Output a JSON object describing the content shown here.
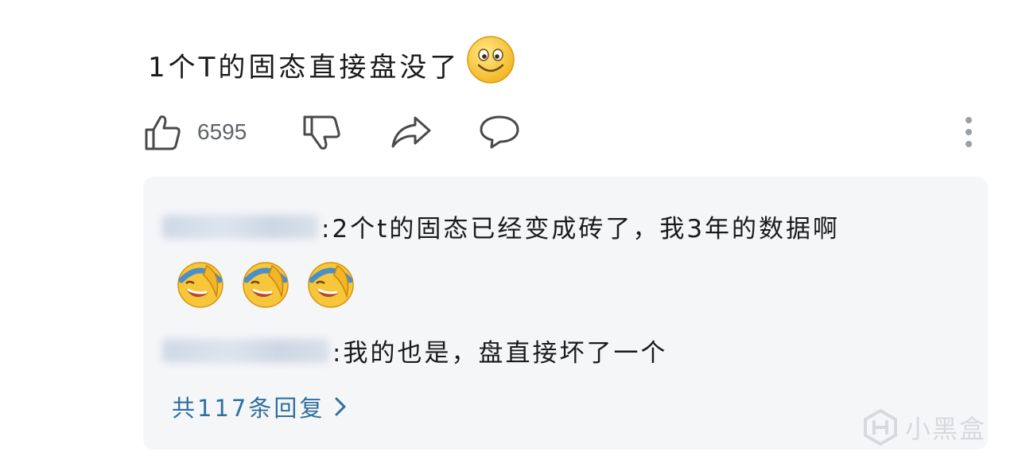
{
  "comment": {
    "text": "1个T的固态直接盘没了",
    "emoji": "smile-emoji"
  },
  "actions": {
    "like_count": "6595",
    "icons": [
      "thumbs-up-icon",
      "thumbs-down-icon",
      "share-icon",
      "comment-icon",
      "more-vertical-icon"
    ]
  },
  "replies": [
    {
      "text": ":2个t的固态已经变成砖了，我3年的数据啊",
      "emojis": [
        "laugh-cry-emoji",
        "laugh-cry-emoji",
        "laugh-cry-emoji"
      ]
    },
    {
      "text": ":我的也是，盘直接坏了一个"
    }
  ],
  "more_replies": {
    "label": "共117条回复"
  },
  "watermark": {
    "text": "小黑盒"
  },
  "colors": {
    "link": "#2f6f9f",
    "panel_bg": "#f5f6f8",
    "icon": "#4a4a4a",
    "emoji_yellow": "#f7c63a"
  }
}
